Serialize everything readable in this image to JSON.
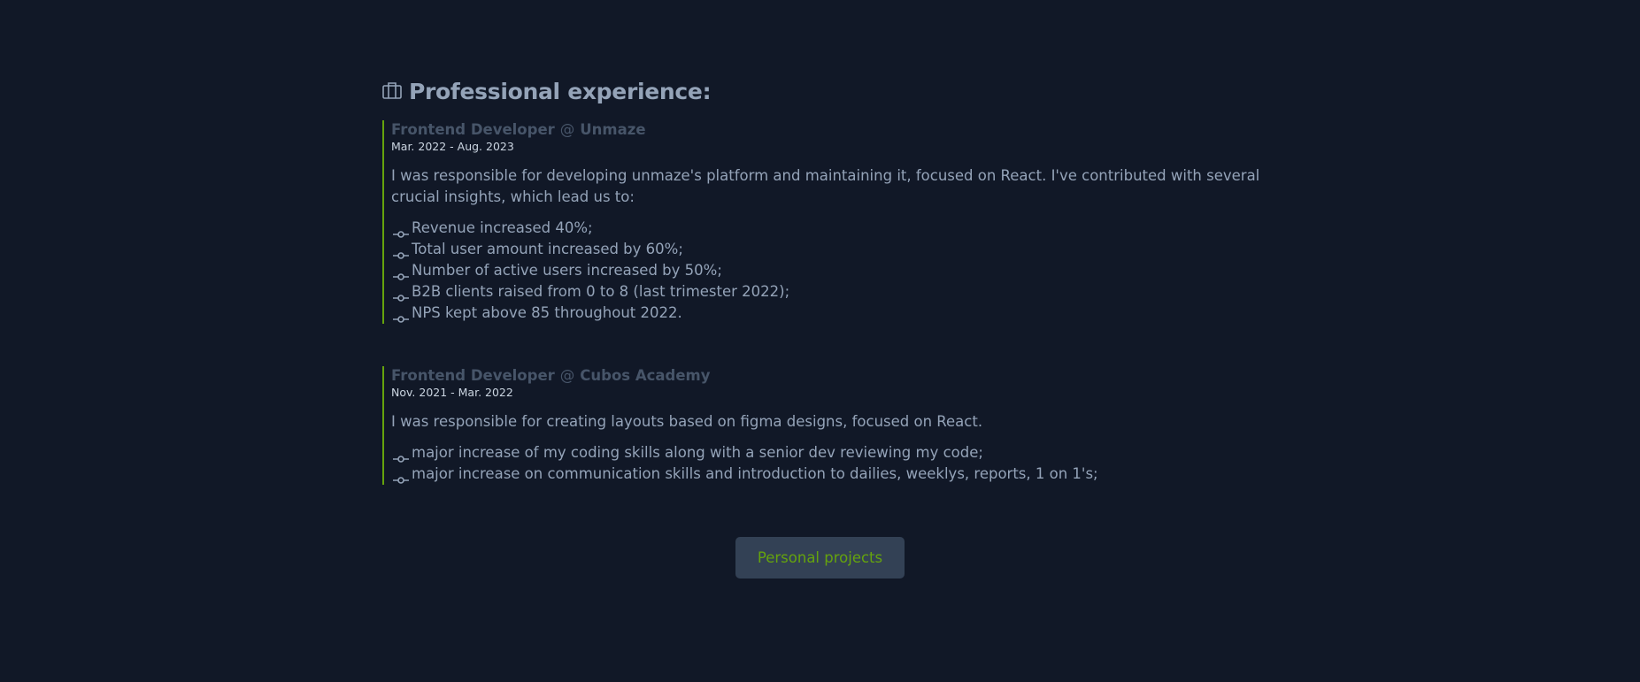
{
  "section": {
    "title": "Professional experience:",
    "icon": "briefcase-icon"
  },
  "jobs": [
    {
      "role": "Frontend Developer",
      "at": "@",
      "company": "Unmaze",
      "dates": "Mar. 2022 - Aug. 2023",
      "description": "I was responsible for developing unmaze's platform and maintaining it, focused on React. I've contributed with several crucial insights, which lead us to:",
      "bullets": [
        "Revenue increased 40%;",
        "Total user amount increased by 60%;",
        "Number of active users increased by 50%;",
        "B2B clients raised from 0 to 8 (last trimester 2022);",
        "NPS kept above 85 throughout 2022."
      ]
    },
    {
      "role": "Frontend Developer",
      "at": "@",
      "company": "Cubos Academy",
      "dates": "Nov. 2021 - Mar. 2022",
      "description": "I was responsible for creating layouts based on figma designs, focused on React.",
      "bullets": [
        "major increase of my coding skills along with a senior dev reviewing my code;",
        "major increase on communication skills and introduction to dailies, weeklys, reports, 1 on 1's;"
      ]
    }
  ],
  "button": {
    "label": "Personal projects"
  },
  "colors": {
    "background": "#111827",
    "accent": "#65a30d",
    "text": "#94a3b8",
    "muted": "#475569",
    "button_bg": "#334155"
  }
}
